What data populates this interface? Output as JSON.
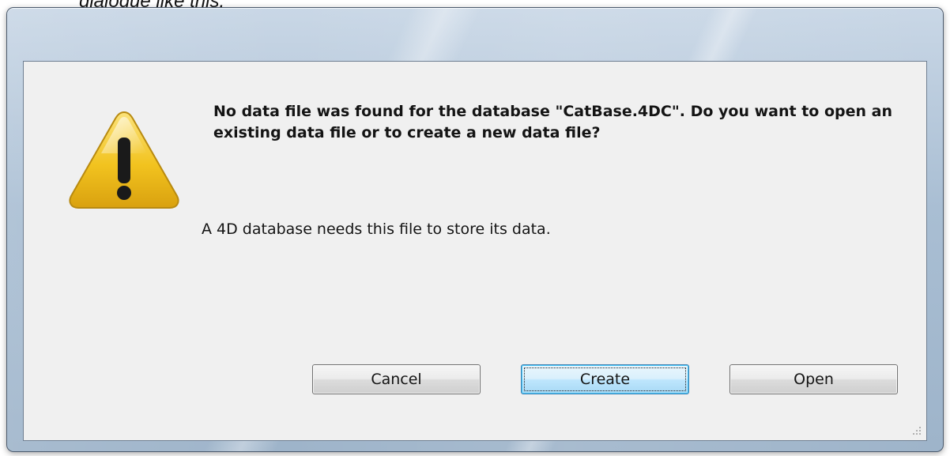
{
  "caption_above": "dialogue like this:",
  "dialog": {
    "message": "No data file was found for the database \"CatBase.4DC\". Do you want to open an existing data file or to create a new data file?",
    "detail": "A 4D database needs this file to store its data.",
    "icon": "warning-icon",
    "buttons": {
      "cancel": "Cancel",
      "create": "Create",
      "open": "Open"
    },
    "default_button": "create"
  },
  "colors": {
    "title_bar": "#a9bed3",
    "content_bg": "#f0f0f0",
    "warning_fill": "#f2c31f",
    "default_button_border": "#3c7fb1"
  }
}
